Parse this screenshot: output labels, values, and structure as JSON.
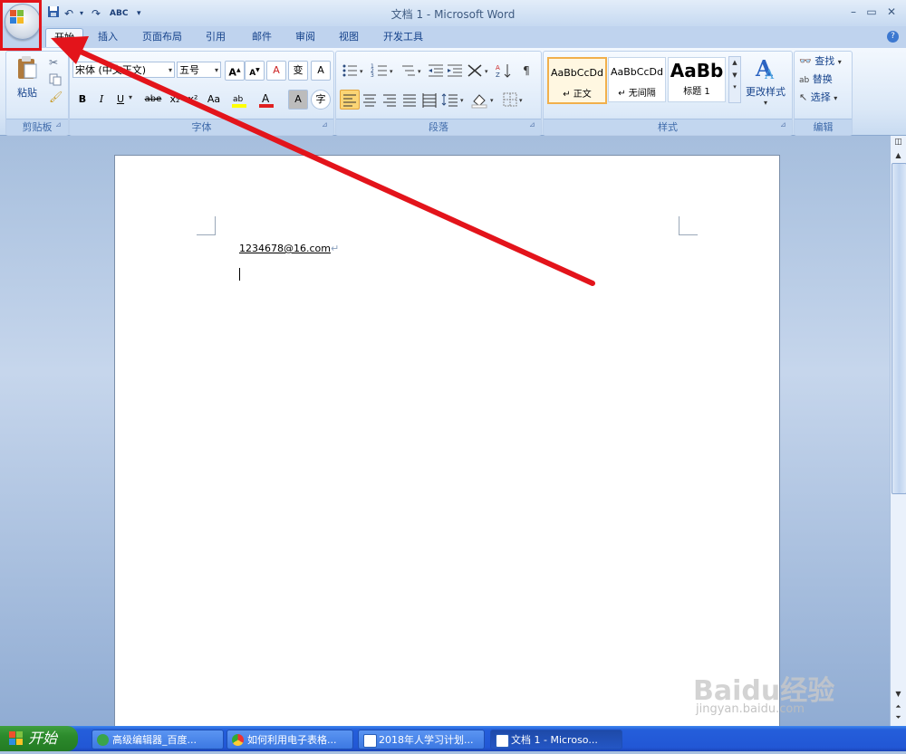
{
  "window": {
    "title": "文档 1 - Microsoft Word",
    "minimize": "–",
    "restore": "▭",
    "close": "✕",
    "ribbon_min": "–",
    "ribbon_restore": "▭",
    "ribbon_close": "✕",
    "help": "?"
  },
  "qat": {
    "save": "💾",
    "undo": "↶",
    "redo": "↷",
    "spell": "ABC",
    "customize": "▾"
  },
  "tabs": [
    "开始",
    "插入",
    "页面布局",
    "引用",
    "邮件",
    "审阅",
    "视图",
    "开发工具"
  ],
  "clipboard": {
    "paste": "粘贴",
    "label": "剪贴板"
  },
  "font": {
    "name": "宋体 (中文正文)",
    "size": "五号",
    "label": "字体",
    "bold": "B",
    "italic": "I",
    "underline": "U",
    "strike": "abe",
    "sub": "x₂",
    "sup": "x²",
    "case": "Aa",
    "grow": "A",
    "shrink": "A",
    "clear": "A",
    "phonetic": "变",
    "border": "A",
    "shade": "A",
    "enclose": "字"
  },
  "paragraph": {
    "label": "段落"
  },
  "styles": {
    "label": "样式",
    "items": [
      {
        "sample": "AaBbCcDd",
        "name": "↵ 正文"
      },
      {
        "sample": "AaBbCcDd",
        "name": "↵ 无间隔"
      },
      {
        "sample": "AaBb",
        "name": "标题 1"
      }
    ],
    "change": "更改样式"
  },
  "editing": {
    "label": "编辑",
    "find": "查找",
    "replace": "替换",
    "select": "选择"
  },
  "document": {
    "email": "1234678@16.com",
    "para_mark": "↵"
  },
  "taskbar": {
    "start": "开始",
    "tasks": [
      "高级编辑器_百度...",
      "如何利用电子表格...",
      "2018年人学习计划...",
      "文档 1 - Microso..."
    ]
  },
  "watermark": {
    "main": "Baidu经验",
    "sub": "jingyan.baidu.com"
  },
  "colors": {
    "highlight": "#e3141b",
    "arrow": "#e3141b"
  }
}
